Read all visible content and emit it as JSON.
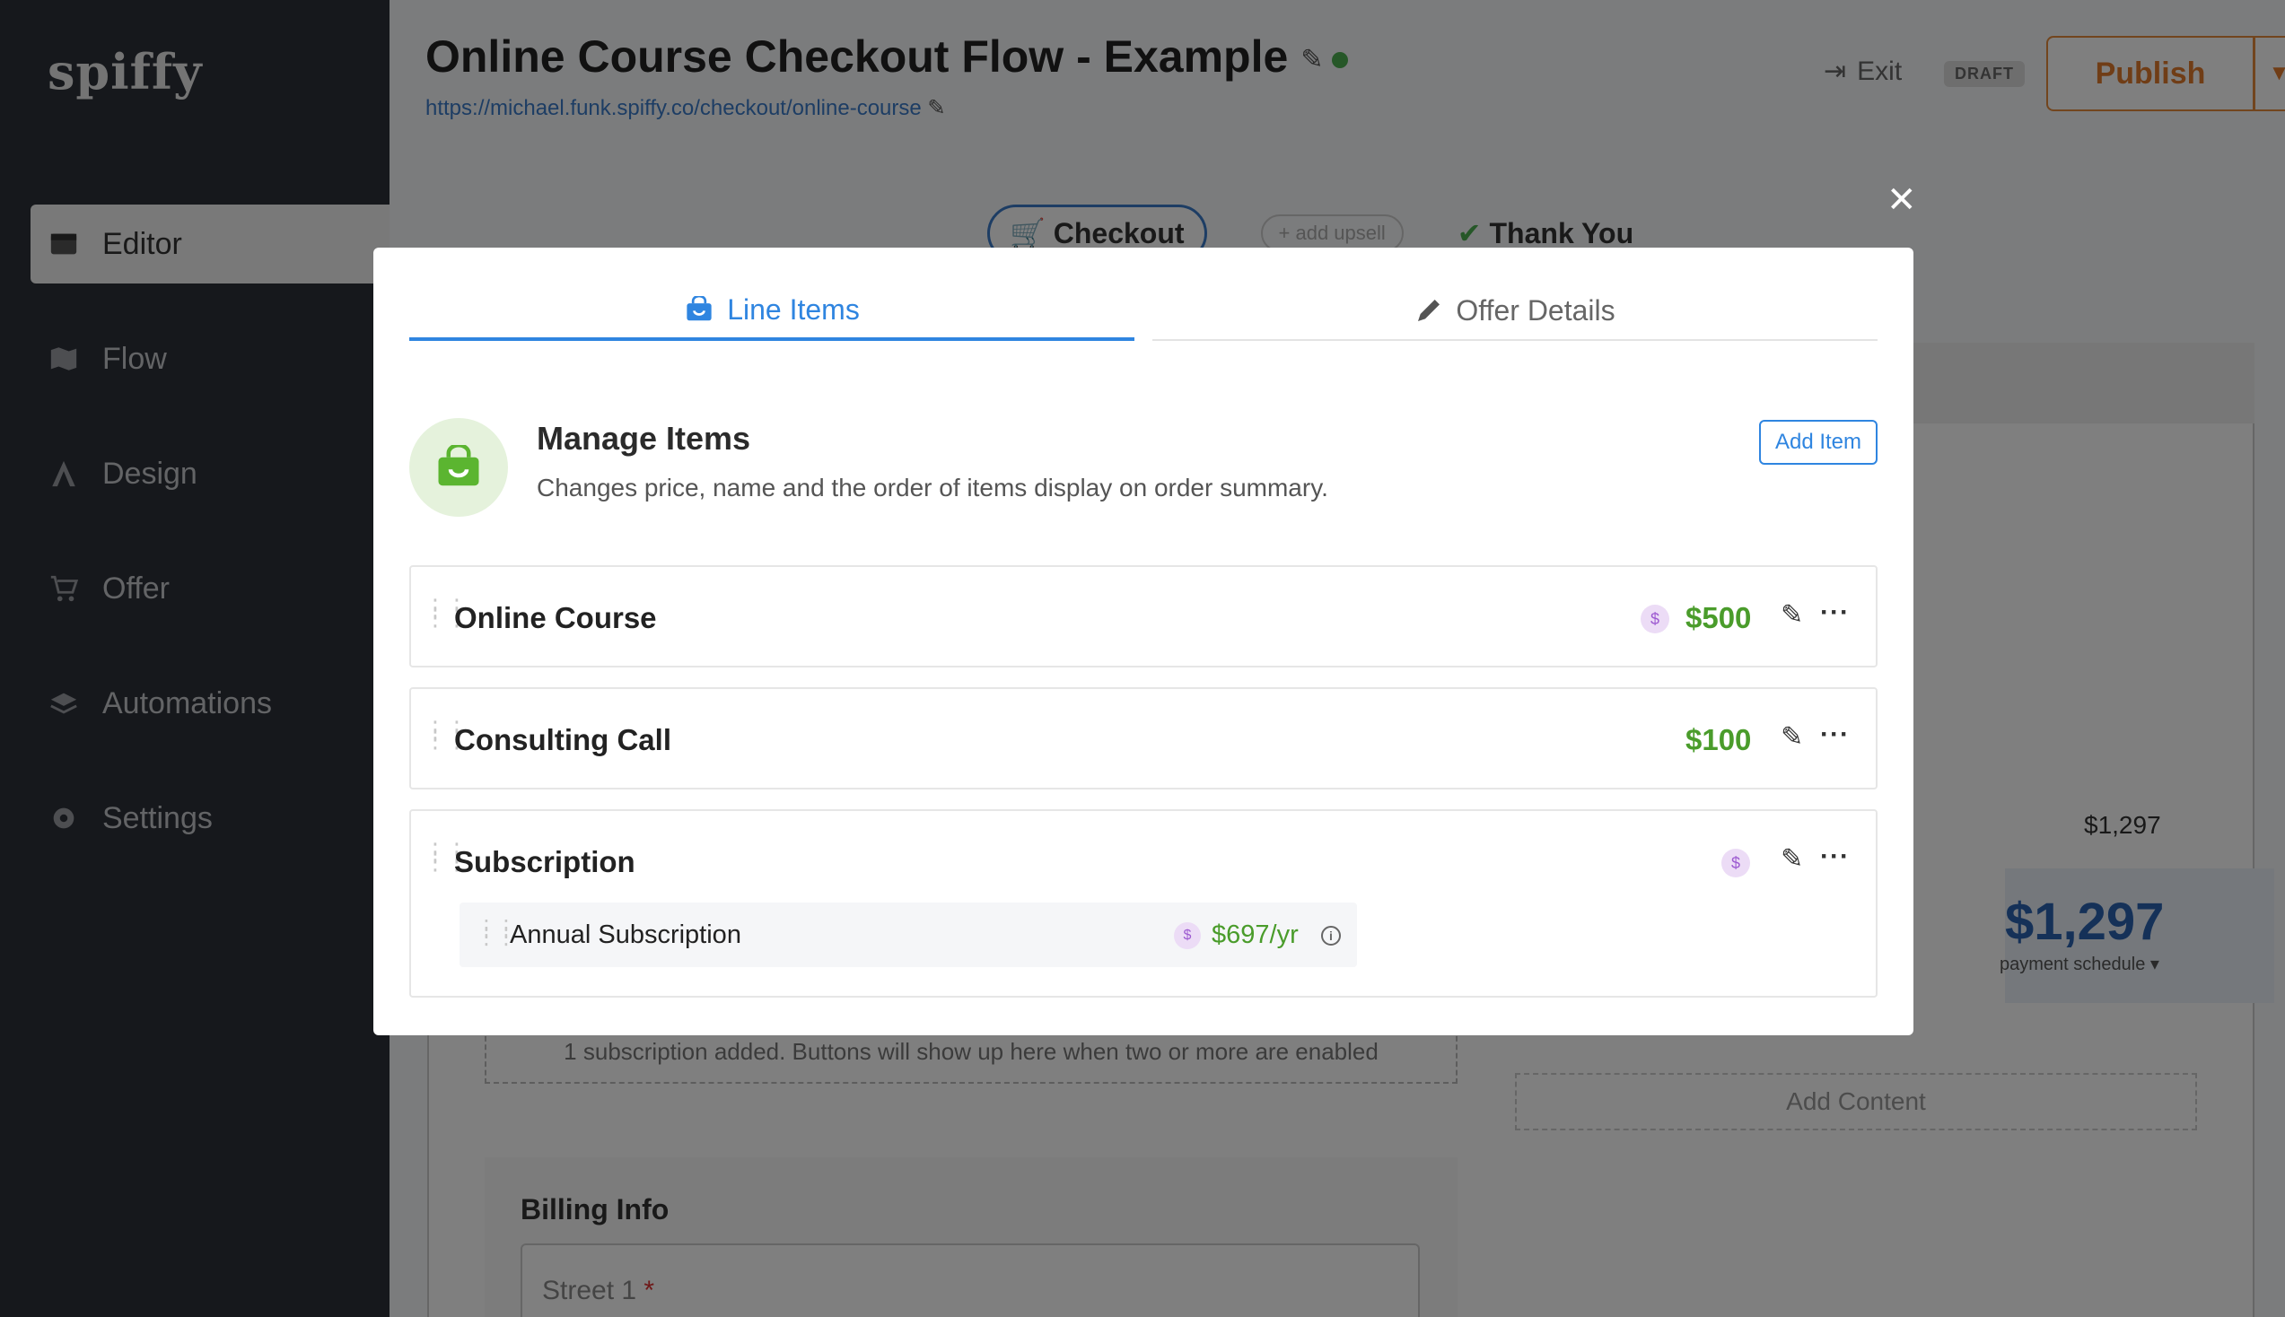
{
  "app": {
    "logo": "spiffy"
  },
  "sidebar": {
    "items": [
      {
        "label": "Editor",
        "icon": "editor-icon",
        "active": true
      },
      {
        "label": "Flow",
        "icon": "map-icon"
      },
      {
        "label": "Design",
        "icon": "design-icon"
      },
      {
        "label": "Offer",
        "icon": "cart-icon"
      },
      {
        "label": "Automations",
        "icon": "layers-icon"
      },
      {
        "label": "Settings",
        "icon": "gear-icon"
      }
    ]
  },
  "header": {
    "title": "Online Course Checkout Flow - Example",
    "url": "https://michael.funk.spiffy.co/checkout/online-course",
    "exit_label": "Exit",
    "draft_label": "DRAFT",
    "publish_label": "Publish"
  },
  "steps": {
    "checkout": "Checkout",
    "add_upsell": "+ add upsell",
    "thank_you": "Thank You"
  },
  "background": {
    "subscription_note": "1 subscription added. Buttons will show up here when two or more are enabled",
    "billing_title": "Billing Info",
    "street_label": "Street 1",
    "street_required": "*",
    "order_price": "$1,297",
    "total_price": "$1,297",
    "payment_schedule": "payment schedule",
    "add_content": "Add Content"
  },
  "modal": {
    "close_label": "✕",
    "tabs": [
      {
        "label": "Line Items",
        "icon": "shopping-bag-icon",
        "active": true
      },
      {
        "label": "Offer Details",
        "icon": "pencil-icon",
        "active": false
      }
    ],
    "manage": {
      "title": "Manage Items",
      "subtitle": "Changes price, name and the order of items display on order summary.",
      "add_button": "Add Item"
    },
    "items": [
      {
        "name": "Online Course",
        "price": "$500"
      },
      {
        "name": "Consulting Call",
        "price": "$100"
      },
      {
        "name": "Subscription",
        "price": ""
      }
    ],
    "subitem": {
      "name": "Annual Subscription",
      "price": "$697/yr"
    }
  },
  "colors": {
    "accent": "#2f85e0",
    "price_green": "#4a9c2b",
    "publish_orange": "#e07a2c",
    "sidebar_bg": "#2d3139"
  }
}
